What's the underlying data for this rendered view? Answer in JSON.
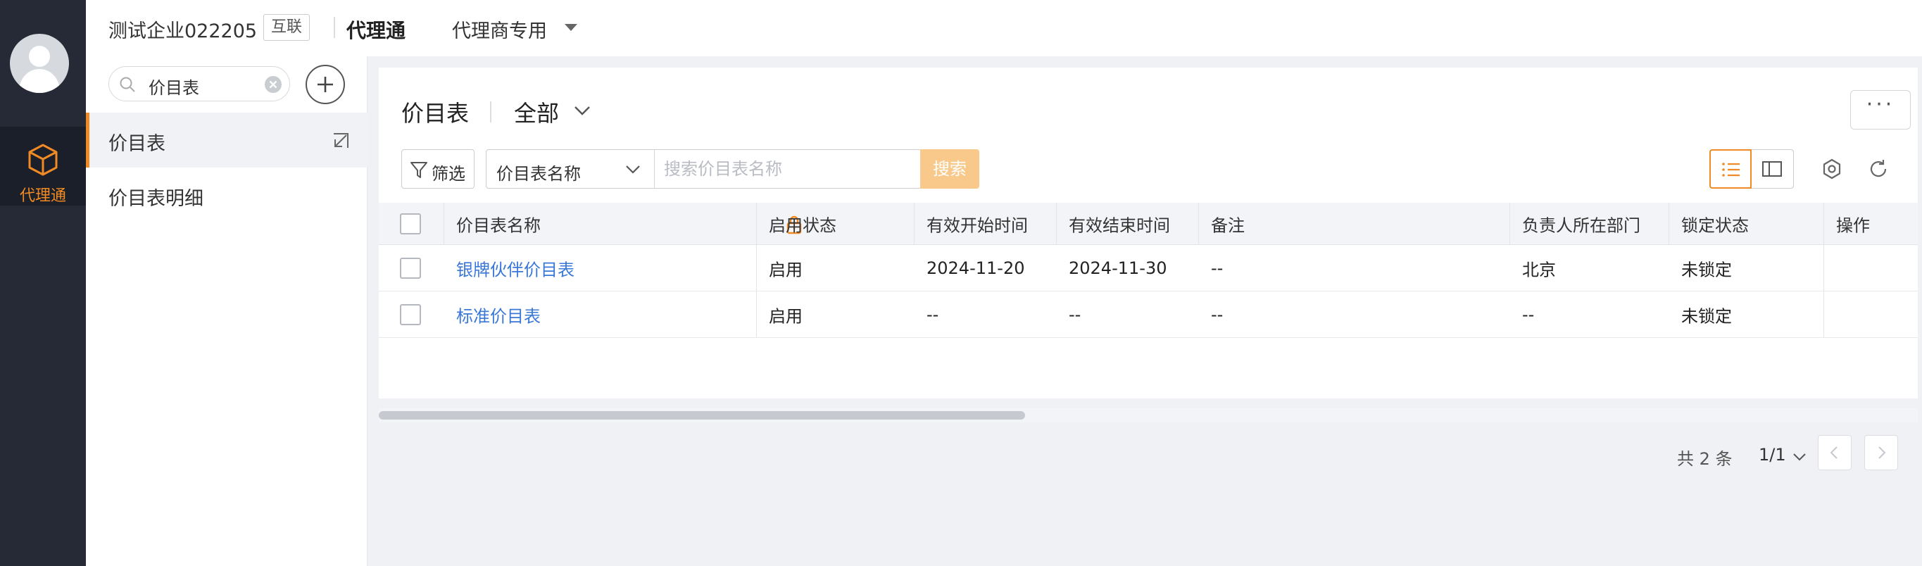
{
  "rail": {
    "avatar_icon": "user-avatar-icon",
    "items": [
      {
        "label": "代理通",
        "icon": "cube-icon",
        "active": true
      }
    ]
  },
  "topbar": {
    "company": "测试企业022205",
    "badge": "互联",
    "app_name": "代理通",
    "menu": "代理商专用",
    "inbox_icon": "inbox-icon"
  },
  "sidenav": {
    "search_value": "价目表",
    "items": [
      {
        "label": "价目表",
        "active": true
      },
      {
        "label": "价目表明细",
        "active": false
      }
    ]
  },
  "main": {
    "title": "价目表",
    "view": "全部",
    "more_label": "···",
    "filter_label": "筛选",
    "search_field": "价目表名称",
    "search_placeholder": "搜索价目表名称",
    "search_button": "搜索",
    "columns": [
      "价目表名称",
      "启用状态",
      "有效开始时间",
      "有效结束时间",
      "备注",
      "负责人所在部门",
      "锁定状态",
      "操作"
    ],
    "rows": [
      {
        "name": "银牌伙伴价目表",
        "status": "启用",
        "start": "2024-11-20",
        "end": "2024-11-30",
        "remark": "--",
        "dept": "北京",
        "lock": "未锁定"
      },
      {
        "name": "标准价目表",
        "status": "启用",
        "start": "--",
        "end": "--",
        "remark": "--",
        "dept": "--",
        "lock": "未锁定"
      }
    ],
    "pagination": {
      "total": "共 2 条",
      "page": "1/1"
    }
  },
  "colors": {
    "accent": "#f08a24",
    "link": "#3a78d8",
    "rail_bg": "#252a36",
    "search_button_bg": "#f8c98a"
  }
}
